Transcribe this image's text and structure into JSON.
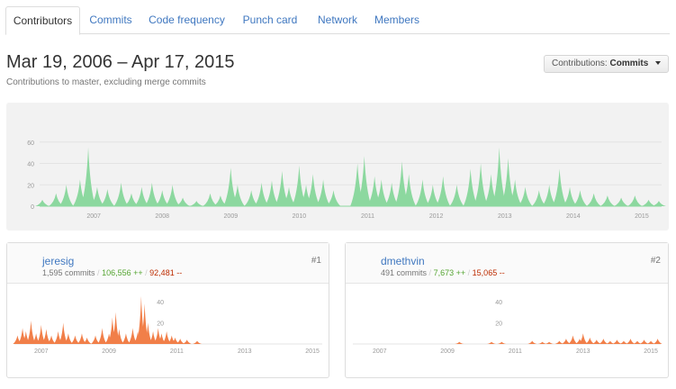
{
  "tabs": [
    "Contributors",
    "Commits",
    "Code frequency",
    "Punch card",
    "Network",
    "Members"
  ],
  "header": {
    "title": "Mar 19, 2006 – Apr 17, 2015",
    "subtitle": "Contributions to master, excluding merge commits"
  },
  "type_select": {
    "label": "Contributions:",
    "value": "Commits"
  },
  "colors": {
    "main_area": "#8cd89f",
    "contributor_area": "#f17f49",
    "link": "#4078c0",
    "additions": "#55a532",
    "deletions": "#bd2c00"
  },
  "chart_data": [
    {
      "type": "area",
      "y_ticks": [
        "60",
        "40",
        "20",
        "0"
      ],
      "x_ticks": [
        "2007",
        "2008",
        "2009",
        "2010",
        "2011",
        "2012",
        "2013",
        "2014",
        "2015"
      ],
      "ylim": [
        0,
        80
      ],
      "xlim": [
        2006.21,
        2015.29
      ],
      "grid": true,
      "peaks": [
        [
          2006.25,
          6
        ],
        [
          2006.45,
          12
        ],
        [
          2006.6,
          20
        ],
        [
          2006.8,
          25
        ],
        [
          2006.92,
          55
        ],
        [
          2007.05,
          18
        ],
        [
          2007.2,
          16
        ],
        [
          2007.4,
          22
        ],
        [
          2007.55,
          12
        ],
        [
          2007.7,
          18
        ],
        [
          2007.85,
          22
        ],
        [
          2008.0,
          15
        ],
        [
          2008.15,
          20
        ],
        [
          2008.3,
          8
        ],
        [
          2008.5,
          5
        ],
        [
          2008.7,
          12
        ],
        [
          2008.85,
          10
        ],
        [
          2009.0,
          36
        ],
        [
          2009.1,
          20
        ],
        [
          2009.3,
          15
        ],
        [
          2009.45,
          22
        ],
        [
          2009.6,
          24
        ],
        [
          2009.75,
          33
        ],
        [
          2009.85,
          18
        ],
        [
          2010.0,
          38
        ],
        [
          2010.1,
          20
        ],
        [
          2010.2,
          30
        ],
        [
          2010.35,
          25
        ],
        [
          2010.5,
          15
        ],
        [
          2010.85,
          40
        ],
        [
          2010.95,
          47
        ],
        [
          2011.1,
          28
        ],
        [
          2011.2,
          25
        ],
        [
          2011.35,
          22
        ],
        [
          2011.5,
          42
        ],
        [
          2011.6,
          30
        ],
        [
          2011.8,
          25
        ],
        [
          2011.95,
          20
        ],
        [
          2012.1,
          28
        ],
        [
          2012.3,
          20
        ],
        [
          2012.5,
          35
        ],
        [
          2012.65,
          40
        ],
        [
          2012.8,
          30
        ],
        [
          2012.92,
          55
        ],
        [
          2013.05,
          45
        ],
        [
          2013.15,
          25
        ],
        [
          2013.3,
          18
        ],
        [
          2013.5,
          15
        ],
        [
          2013.65,
          20
        ],
        [
          2013.8,
          35
        ],
        [
          2013.95,
          18
        ],
        [
          2014.1,
          15
        ],
        [
          2014.3,
          12
        ],
        [
          2014.5,
          10
        ],
        [
          2014.7,
          8
        ],
        [
          2014.9,
          10
        ],
        [
          2015.1,
          6
        ],
        [
          2015.25,
          5
        ]
      ]
    },
    {
      "type": "area",
      "y_ticks": [
        "40",
        "20"
      ],
      "x_ticks": [
        "2007",
        "2009",
        "2011",
        "2013",
        "2015"
      ],
      "ylim": [
        0,
        50
      ],
      "xlim": [
        2006.21,
        2015.29
      ],
      "peaks": [
        [
          2006.3,
          8
        ],
        [
          2006.45,
          15
        ],
        [
          2006.55,
          12
        ],
        [
          2006.7,
          22
        ],
        [
          2006.85,
          10
        ],
        [
          2007.0,
          18
        ],
        [
          2007.15,
          14
        ],
        [
          2007.3,
          8
        ],
        [
          2007.5,
          12
        ],
        [
          2007.65,
          20
        ],
        [
          2007.8,
          10
        ],
        [
          2008.0,
          8
        ],
        [
          2008.2,
          10
        ],
        [
          2008.35,
          6
        ],
        [
          2008.6,
          8
        ],
        [
          2008.8,
          15
        ],
        [
          2009.0,
          10
        ],
        [
          2009.1,
          25
        ],
        [
          2009.2,
          30
        ],
        [
          2009.3,
          14
        ],
        [
          2009.5,
          10
        ],
        [
          2009.7,
          15
        ],
        [
          2009.85,
          12
        ],
        [
          2009.95,
          45
        ],
        [
          2010.05,
          38
        ],
        [
          2010.15,
          20
        ],
        [
          2010.3,
          12
        ],
        [
          2010.45,
          15
        ],
        [
          2010.55,
          10
        ],
        [
          2010.7,
          12
        ],
        [
          2010.85,
          8
        ],
        [
          2010.95,
          6
        ],
        [
          2011.1,
          5
        ],
        [
          2011.3,
          4
        ],
        [
          2011.6,
          3
        ]
      ]
    },
    {
      "type": "area",
      "y_ticks": [
        "40",
        "20"
      ],
      "x_ticks": [
        "2007",
        "2009",
        "2011",
        "2013",
        "2015"
      ],
      "ylim": [
        0,
        50
      ],
      "xlim": [
        2006.21,
        2015.29
      ],
      "peaks": [
        [
          2009.35,
          2
        ],
        [
          2010.3,
          2
        ],
        [
          2010.6,
          2
        ],
        [
          2011.5,
          3
        ],
        [
          2011.8,
          2
        ],
        [
          2012.0,
          2
        ],
        [
          2012.3,
          3
        ],
        [
          2012.5,
          5
        ],
        [
          2012.7,
          8
        ],
        [
          2012.9,
          5
        ],
        [
          2013.0,
          10
        ],
        [
          2013.2,
          6
        ],
        [
          2013.4,
          4
        ],
        [
          2013.6,
          5
        ],
        [
          2013.8,
          3
        ],
        [
          2014.0,
          4
        ],
        [
          2014.2,
          3
        ],
        [
          2014.4,
          5
        ],
        [
          2014.6,
          3
        ],
        [
          2014.8,
          4
        ],
        [
          2015.0,
          3
        ],
        [
          2015.2,
          5
        ]
      ]
    }
  ],
  "contributors": [
    {
      "login": "jeresig",
      "commits": "1,595 commits",
      "additions": "106,556 ++",
      "deletions": "92,481 --",
      "rank": "#1"
    },
    {
      "login": "dmethvin",
      "commits": "491 commits",
      "additions": "7,673 ++",
      "deletions": "15,065 --",
      "rank": "#2"
    }
  ]
}
